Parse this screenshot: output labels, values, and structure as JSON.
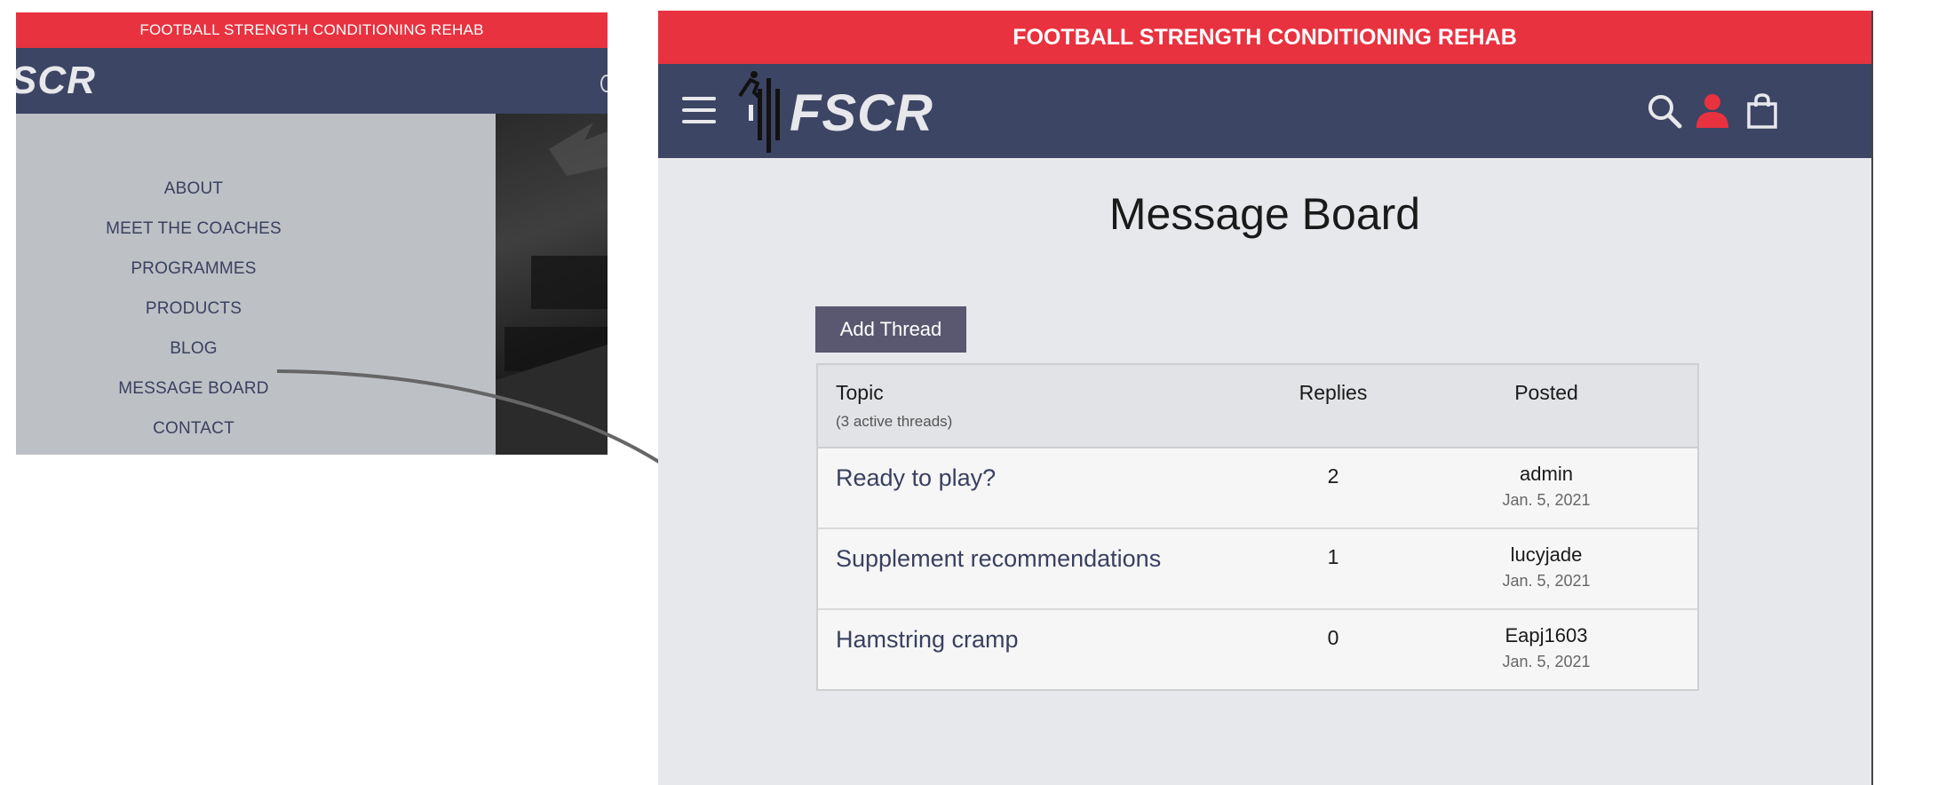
{
  "left_preview": {
    "banner_text": "FOOTBALL STRENGTH CONDITIONING REHAB",
    "logo_text": "SCR",
    "menu_items": [
      {
        "label": "ABOUT"
      },
      {
        "label": "MEET THE COACHES"
      },
      {
        "label": "PROGRAMMES"
      },
      {
        "label": "PRODUCTS"
      },
      {
        "label": "BLOG"
      },
      {
        "label": "MESSAGE BOARD"
      },
      {
        "label": "CONTACT"
      }
    ]
  },
  "site": {
    "banner_text": "FOOTBALL STRENGTH CONDITIONING REHAB",
    "logo_text": "FSCR",
    "icons": {
      "menu": "hamburger-icon",
      "search": "search-icon",
      "account": "user-icon",
      "cart": "shopping-bag-icon"
    },
    "colors": {
      "brand_red": "#e8323f",
      "header_navy": "#3c4563",
      "button_gray": "#5a5870",
      "link_color": "#3a4060"
    }
  },
  "page": {
    "title": "Message Board",
    "add_thread_label": "Add Thread"
  },
  "table": {
    "headers": {
      "topic": "Topic",
      "topic_sub": "(3 active threads)",
      "replies": "Replies",
      "posted": "Posted"
    },
    "rows": [
      {
        "topic": "Ready to play?",
        "replies": "2",
        "user": "admin",
        "date": "Jan. 5, 2021"
      },
      {
        "topic": "Supplement recommendations",
        "replies": "1",
        "user": "lucyjade",
        "date": "Jan. 5, 2021"
      },
      {
        "topic": "Hamstring cramp",
        "replies": "0",
        "user": "Eapj1603",
        "date": "Jan. 5, 2021"
      }
    ]
  }
}
